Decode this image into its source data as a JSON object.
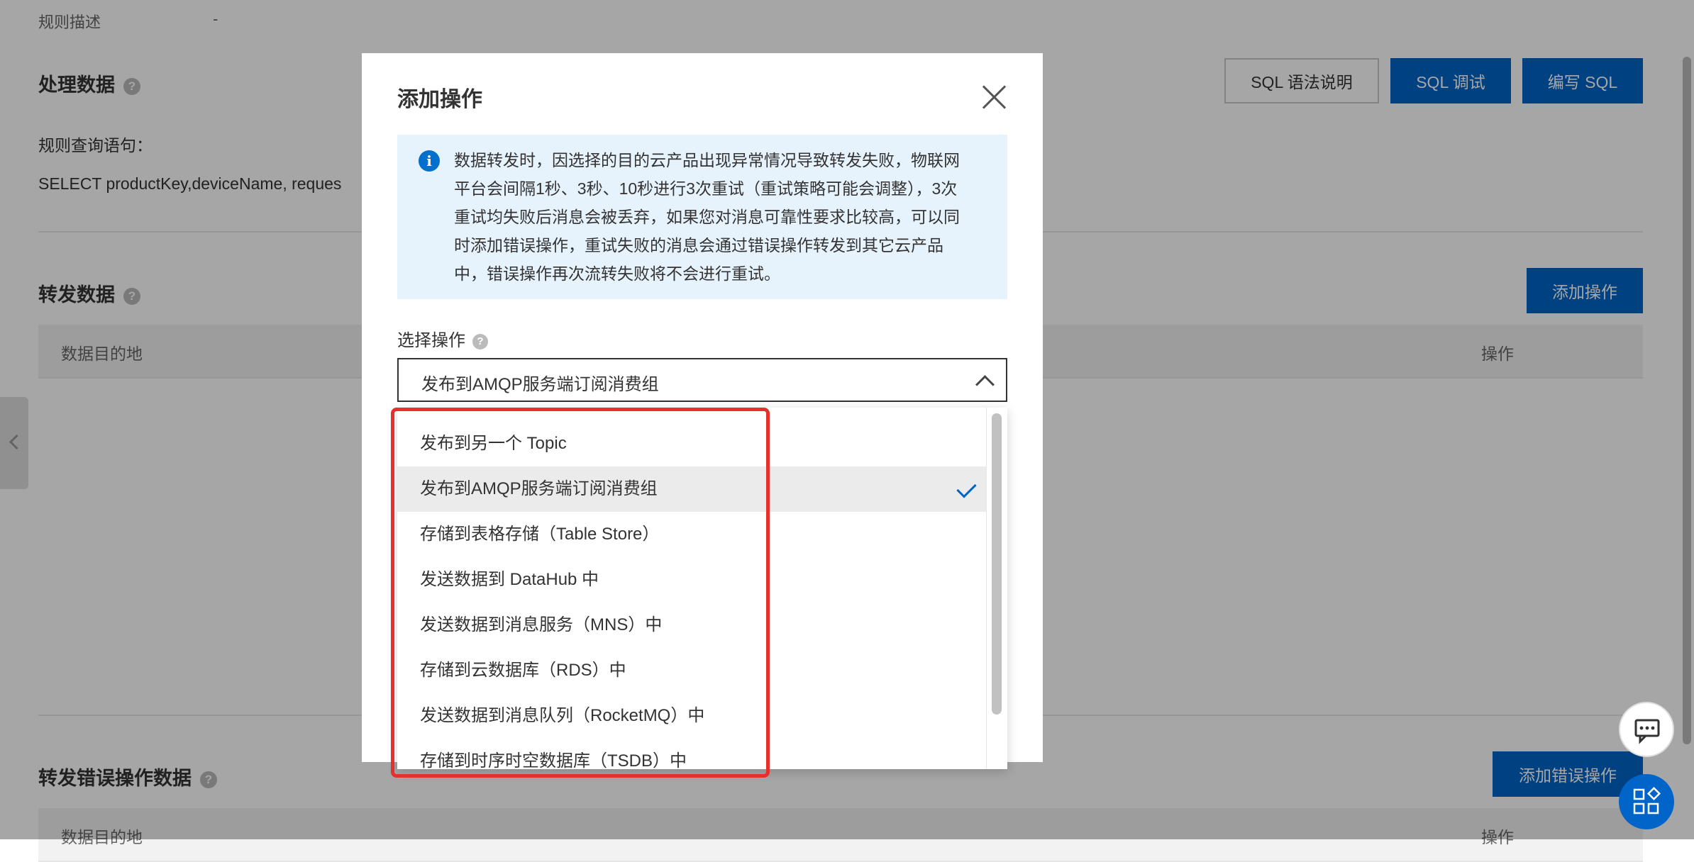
{
  "background": {
    "rule_desc_label": "规则描述",
    "rule_desc_value": "-",
    "process_data_title": "处理数据",
    "sql_help_button": "SQL 语法说明",
    "sql_debug_button": "SQL 调试",
    "write_sql_button": "编写 SQL",
    "query_label": "规则查询语句：",
    "query_value": "SELECT productKey,deviceName, reques",
    "forward_data_title": "转发数据",
    "add_action_button": "添加操作",
    "forward_col_destination": "数据目的地",
    "forward_col_actions": "操作",
    "error_data_title": "转发错误操作数据",
    "add_error_button": "添加错误操作",
    "error_col_destination": "数据目的地",
    "error_col_actions": "操作"
  },
  "modal": {
    "title": "添加操作",
    "notice_lines": [
      "数据转发时，因选择的目的云产品出现异常情况导致转发失败，物联网",
      "平台会间隔1秒、3秒、10秒进行3次重试（重试策略可能会调整），3次",
      "重试均失败后消息会被丢弃，如果您对消息可靠性要求比较高，可以同",
      "时添加错误操作，重试失败的消息会通过错误操作转发到其它云产品",
      "中，错误操作再次流转失败将不会进行重试。"
    ],
    "select_label": "选择操作",
    "select_value": "发布到AMQP服务端订阅消费组",
    "options": [
      "发布到另一个 Topic",
      "发布到AMQP服务端订阅消费组",
      "存储到表格存储（Table Store）",
      "发送数据到 DataHub 中",
      "发送数据到消息服务（MNS）中",
      "存储到云数据库（RDS）中",
      "发送数据到消息队列（RocketMQ）中",
      "存储到时序时空数据库（TSDB）中"
    ],
    "selected_index": 1
  },
  "colors": {
    "primary": "#0064c8",
    "highlight_box": "#e4312b",
    "notice_bg": "#e6f2fc"
  }
}
